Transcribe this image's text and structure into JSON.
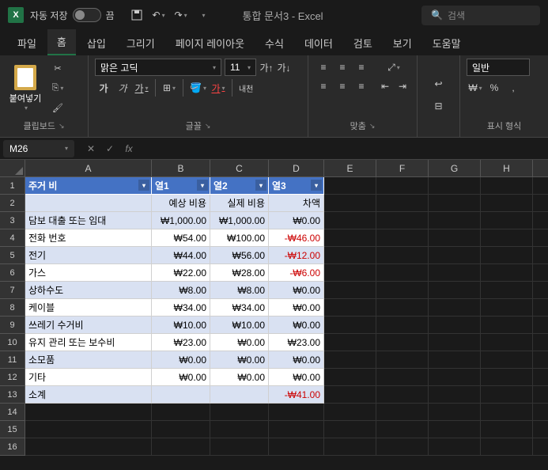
{
  "titlebar": {
    "autosave_label": "자동 저장",
    "autosave_state": "끔",
    "workbook_title": "통합 문서3 - Excel",
    "search_placeholder": "검색"
  },
  "tabs": {
    "file": "파일",
    "home": "홈",
    "insert": "삽입",
    "draw": "그리기",
    "layout": "페이지 레이아웃",
    "formulas": "수식",
    "data": "데이터",
    "review": "검토",
    "view": "보기",
    "help": "도움말"
  },
  "ribbon": {
    "clipboard": {
      "paste": "붙여넣기",
      "label": "클립보드"
    },
    "font": {
      "name": "맑은 고딕",
      "size": "11",
      "label": "글꼴",
      "bold": "가",
      "italic": "가",
      "underline": "가",
      "vtext": "내천"
    },
    "align": {
      "label": "맞춤"
    },
    "number": {
      "general": "일반",
      "label": "표시 형식"
    }
  },
  "namebox": "M26",
  "sheet": {
    "cols": [
      "A",
      "B",
      "C",
      "D",
      "E",
      "F",
      "G",
      "H"
    ],
    "header": {
      "a": "주거 비",
      "b": "열1",
      "c": "열2",
      "d": "열3"
    },
    "subhead": {
      "b": "예상 비용",
      "c": "실제 비용",
      "d": "차액"
    },
    "rows": [
      {
        "a": "담보 대출 또는 임대",
        "b": "₩1,000.00",
        "c": "₩1,000.00",
        "d": "₩0.00",
        "neg": false,
        "band": true
      },
      {
        "a": "전화 번호",
        "b": "₩54.00",
        "c": "₩100.00",
        "d": "-₩46.00",
        "neg": true,
        "band": false
      },
      {
        "a": "전기",
        "b": "₩44.00",
        "c": "₩56.00",
        "d": "-₩12.00",
        "neg": true,
        "band": true
      },
      {
        "a": "가스",
        "b": "₩22.00",
        "c": "₩28.00",
        "d": "-₩6.00",
        "neg": true,
        "band": false
      },
      {
        "a": "상하수도",
        "b": "₩8.00",
        "c": "₩8.00",
        "d": "₩0.00",
        "neg": false,
        "band": true
      },
      {
        "a": "케이블",
        "b": "₩34.00",
        "c": "₩34.00",
        "d": "₩0.00",
        "neg": false,
        "band": false
      },
      {
        "a": "쓰레기 수거비",
        "b": "₩10.00",
        "c": "₩10.00",
        "d": "₩0.00",
        "neg": false,
        "band": true
      },
      {
        "a": "유지 관리 또는 보수비",
        "b": "₩23.00",
        "c": "₩0.00",
        "d": "₩23.00",
        "neg": false,
        "band": false
      },
      {
        "a": "소모품",
        "b": "₩0.00",
        "c": "₩0.00",
        "d": "₩0.00",
        "neg": false,
        "band": true
      },
      {
        "a": "기타",
        "b": "₩0.00",
        "c": "₩0.00",
        "d": "₩0.00",
        "neg": false,
        "band": false
      }
    ],
    "subtotal": {
      "a": "소계",
      "d": "-₩41.00"
    }
  }
}
